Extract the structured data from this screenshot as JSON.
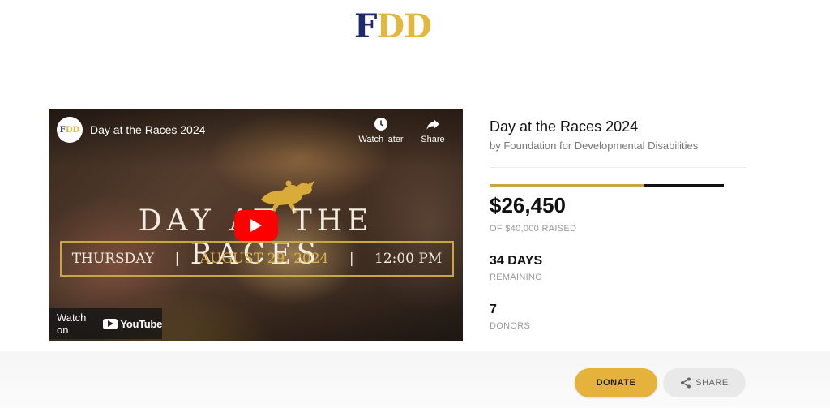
{
  "logo": {
    "first": "F",
    "rest": "DD"
  },
  "video": {
    "channel_logo": {
      "first": "F",
      "rest": "DD"
    },
    "title": "Day at the Races 2024",
    "watch_later_label": "Watch later",
    "share_label": "Share",
    "card_text": "DAY AT THE RACES",
    "date_band": {
      "day": "THURSDAY",
      "date": "AUGUST 29, 2024",
      "time": "12:00 PM",
      "separator": "|"
    },
    "watch_on_label": "Watch on",
    "youtube_label": "YouTube",
    "icons": [
      "clock-icon",
      "share-arrow-icon",
      "play-icon",
      "youtube-logo-icon"
    ]
  },
  "campaign": {
    "title": "Day at the Races 2024",
    "organizer": "by Foundation for Developmental Disabilities",
    "progress_fraction": 0.661,
    "raised": "$26,450",
    "raised_label": "OF $40,000 RAISED",
    "days": "34 DAYS",
    "days_label": "REMAINING",
    "donors": "7",
    "donors_label": "DONORS"
  },
  "actions": {
    "donate_label": "DONATE",
    "share_label": "SHARE",
    "share_icon": "share-nodes-icon"
  },
  "colors": {
    "brand_navy": "#1e2a6b",
    "brand_gold": "#e2b73b",
    "donate_button": "#e5b23b",
    "progress_fill": "#c9a544"
  }
}
